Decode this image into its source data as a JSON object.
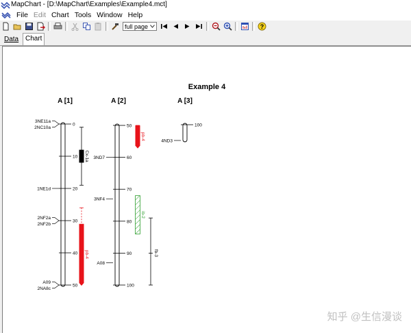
{
  "window": {
    "title": "MapChart - [D:\\MapChart\\Examples\\Example4.mct]"
  },
  "menu": {
    "items": [
      {
        "label": "File",
        "enabled": true
      },
      {
        "label": "Edit",
        "enabled": false
      },
      {
        "label": "Chart",
        "enabled": true
      },
      {
        "label": "Tools",
        "enabled": true
      },
      {
        "label": "Window",
        "enabled": true
      },
      {
        "label": "Help",
        "enabled": true
      }
    ]
  },
  "toolbar": {
    "zoom_value": "full page"
  },
  "tabs": [
    {
      "label": "Data"
    },
    {
      "label": "Chart"
    }
  ],
  "watermark": "知乎 @生信漫谈",
  "colors": {
    "red_qtl": "#e8131a",
    "green_qtl": "#2e9e2e",
    "black_qtl": "#000000",
    "dashed_red": "#e8131a"
  },
  "chart_data": {
    "type": "linkage-map",
    "title": "Example 4",
    "groups": [
      {
        "name": "A [1]",
        "range": [
          0,
          50
        ],
        "ticks": [
          0,
          10,
          20,
          30,
          40,
          50
        ],
        "markers": [
          {
            "name": "3NE11a",
            "pos": 0
          },
          {
            "name": "2NC10a",
            "pos": 0
          },
          {
            "name": "1NE1d",
            "pos": 20
          },
          {
            "name": "2NF2a",
            "pos": 30
          },
          {
            "name": "2NF2b",
            "pos": 30
          },
          {
            "name": "A09",
            "pos": 50
          },
          {
            "name": "2NA8c",
            "pos": 50
          }
        ],
        "qtls": [
          {
            "label": "Cx-1a",
            "style": "solid-black",
            "range": [
              1,
              19
            ],
            "core": [
              8,
              12
            ]
          },
          {
            "label": "pb-4",
            "style": "solid-red",
            "range": [
              26,
              50
            ],
            "core": [
              31,
              50
            ]
          }
        ]
      },
      {
        "name": "A [2]",
        "range": [
          50,
          100
        ],
        "ticks": [
          50,
          60,
          70,
          80,
          90,
          100
        ],
        "markers": [
          {
            "name": "3ND7",
            "pos": 60
          },
          {
            "name": "3NF4",
            "pos": 73
          },
          {
            "name": "A08",
            "pos": 93
          }
        ],
        "qtls": [
          {
            "label": "pb-4",
            "style": "solid-red",
            "range": [
              50,
              60
            ],
            "core": [
              50,
              57
            ]
          },
          {
            "label": "ib-2",
            "style": "hatched-green",
            "range": [
              72,
              84
            ],
            "core": [
              72,
              84
            ]
          },
          {
            "label": "fb-3",
            "style": "line-black",
            "range": [
              79,
              100
            ],
            "core": [
              89,
              91
            ]
          }
        ]
      },
      {
        "name": "A [3]",
        "range": [
          100,
          105
        ],
        "ticks": [
          100
        ],
        "markers": [
          {
            "name": "4ND3",
            "pos": 105
          }
        ],
        "qtls": []
      }
    ]
  }
}
